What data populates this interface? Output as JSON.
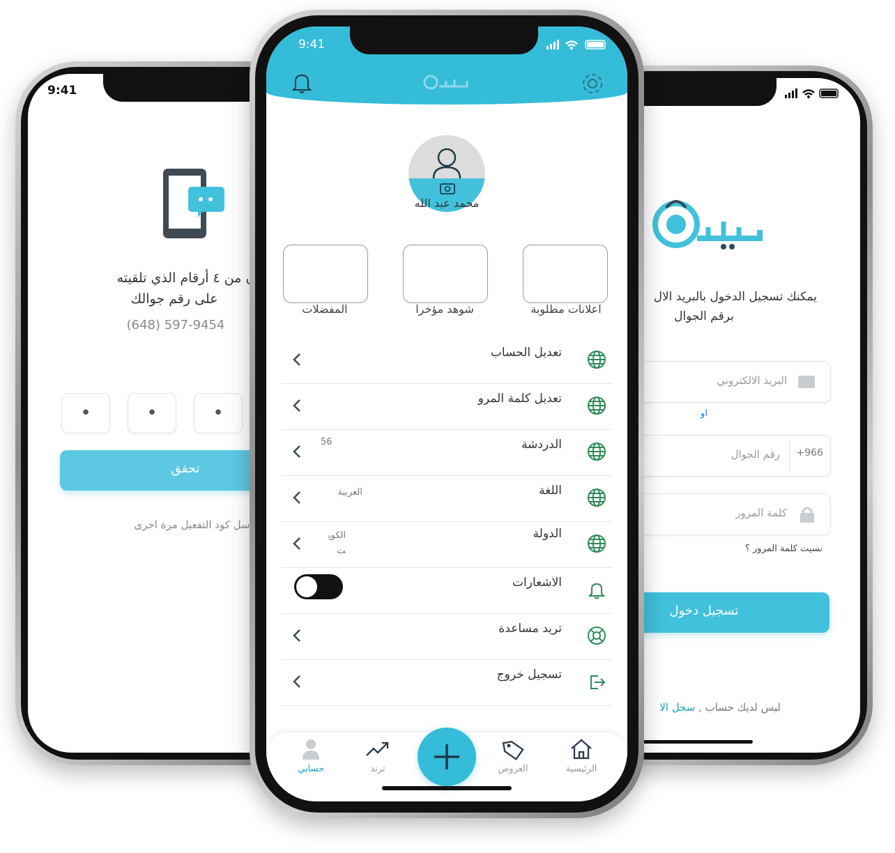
{
  "colors": {
    "accent": "#41c1dc",
    "accent_dark": "#1aa3c3",
    "green_icon": "#2e8b57",
    "text": "#333333",
    "muted": "#8a8a8a"
  },
  "verify_screen": {
    "time": "9:41",
    "instruction_line1": "ز المكون من ٤ أرقام الذي تلقيته",
    "instruction_line2": "على رقم جوالك",
    "phone_number": "(648) 597-9454",
    "code_digits": [
      "•",
      "•",
      "•"
    ],
    "verify_button": "تحقق",
    "resend_text": "أرسل كود التفعيل مرة اخرى",
    "illustration_icon": "phone-chat-icon"
  },
  "profile_screen": {
    "time": "9:41",
    "header_icons": [
      "bell-icon",
      "logo",
      "gear-icon"
    ],
    "user_name": "محمد عبد الله",
    "tiles": [
      {
        "label": "اعلانات مطلوبة"
      },
      {
        "label": "شوهد مؤخرا"
      },
      {
        "label": "المفضلات"
      }
    ],
    "menu": [
      {
        "label": "تعديل الحساب",
        "value": "",
        "icon": "globe-icon"
      },
      {
        "label": "تعديل كلمة المرو",
        "value": "",
        "icon": "globe-icon"
      },
      {
        "label": "الدردشة",
        "value": "56",
        "icon": "globe-icon"
      },
      {
        "label": "اللغة",
        "value": "العربية",
        "icon": "globe-icon"
      },
      {
        "label": "الدولة",
        "value": "الكويت",
        "icon": "globe-icon"
      },
      {
        "label": "الاشعارات",
        "value": "",
        "icon": "bell-icon",
        "toggle": "on"
      },
      {
        "label": "تريد مساعدة",
        "value": "",
        "icon": "lifebuoy-icon"
      },
      {
        "label": "تسجيل خروج",
        "value": "",
        "icon": "logout-icon"
      }
    ],
    "bottom_nav": [
      {
        "label": "الرئيسية",
        "icon": "home-icon"
      },
      {
        "label": "العروض",
        "icon": "tag-icon"
      },
      {
        "label": "ترند",
        "icon": "trend-icon"
      },
      {
        "label": "حسابي",
        "icon": "user-icon"
      }
    ],
    "add_icon": "plus-icon"
  },
  "login_screen": {
    "logo_text": "بيعان",
    "intro_line1": "يمكنك تسجيل الدخول بالبريد الال",
    "intro_line2": "برقم الجوال",
    "email_placeholder": "البريد الالكتروني",
    "or_text": "او",
    "country_code": "+966",
    "phone_placeholder": "رقم الجوال",
    "password_placeholder": "كلمة المرور",
    "forgot_password": "نسيت كلمة المرور ؟",
    "login_button": "تسجيل دخول",
    "no_account": "ليس لديك حساب ,",
    "register_link": "سجل الا"
  }
}
